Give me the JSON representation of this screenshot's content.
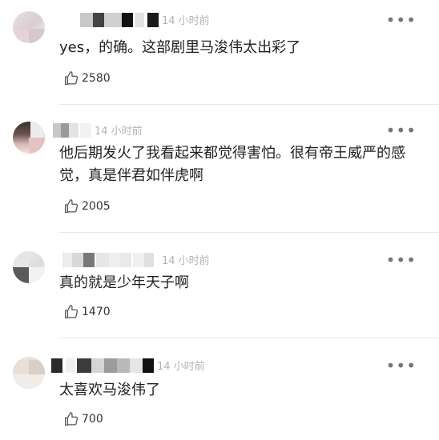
{
  "comments": [
    {
      "time": "14 小时前",
      "text": "yes，的确。这部剧里马浚伟太出彩了",
      "likes": "2580",
      "more_label": "•••"
    },
    {
      "time": "14 小时前",
      "text": "他后期发火了我看起来都觉得害怕。很有帝王威严的感觉，真是伴君如伴虎啊",
      "likes": "2005",
      "more_label": "•••"
    },
    {
      "time": "14 小时前",
      "text": "真的就是少年天子啊",
      "likes": "1470",
      "more_label": "•••"
    },
    {
      "time": "14 小时前",
      "text": "太喜欢马浚伟了",
      "likes": "700",
      "more_label": "•••"
    }
  ],
  "icons": {
    "like": "thumbs-up-icon",
    "more": "more-dots-icon"
  },
  "colors": {
    "text": "#1f1f1f",
    "meta": "#b3b3b3",
    "divider": "#e8e8e8"
  }
}
